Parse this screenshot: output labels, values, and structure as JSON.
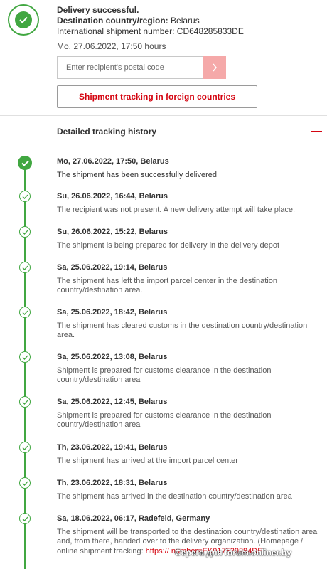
{
  "header": {
    "status_title": "Delivery successful.",
    "destination_label": "Destination country/region:",
    "destination_value": "Belarus",
    "shipment_number_label": "International shipment number:",
    "shipment_number_value": "CD648285833DE",
    "datetime": "Mo, 27.06.2022, 17:50 hours",
    "status_icon": "check-circle-icon",
    "accent_color": "#41a741"
  },
  "postal_form": {
    "placeholder": "Enter recipient's postal code",
    "submit_icon": "chevron-right-icon"
  },
  "tracking_button": {
    "label": "Shipment tracking in foreign countries",
    "color": "#d40511"
  },
  "history": {
    "title": "Detailed tracking history",
    "toggle_icon": "minus-icon"
  },
  "events": [
    {
      "title": "Mo, 27.06.2022, 17:50, Belarus",
      "desc": "The shipment has been successfully delivered"
    },
    {
      "title": "Su, 26.06.2022, 16:44, Belarus",
      "desc": "The recipient was not present. A new delivery attempt will take place."
    },
    {
      "title": "Su, 26.06.2022, 15:22, Belarus",
      "desc": "The shipment is being prepared for delivery in the delivery depot"
    },
    {
      "title": "Sa, 25.06.2022, 19:14, Belarus",
      "desc": "The shipment has left the import parcel center in the destination country/destination area."
    },
    {
      "title": "Sa, 25.06.2022, 18:42, Belarus",
      "desc": "The shipment has cleared customs in the destination country/destination area."
    },
    {
      "title": "Sa, 25.06.2022, 13:08, Belarus",
      "desc": "Shipment is prepared for customs clearance in the destination country/destination area"
    },
    {
      "title": "Sa, 25.06.2022, 12:45, Belarus",
      "desc": "Shipment is prepared for customs clearance in the destination country/destination area"
    },
    {
      "title": "Th, 23.06.2022, 19:41, Belarus",
      "desc": "The shipment has arrived at the import parcel center"
    },
    {
      "title": "Th, 23.06.2022, 18:31, Belarus",
      "desc": "The shipment has arrived in the destination country/destination area"
    },
    {
      "title": "Sa, 18.06.2022, 06:17, Radefeld, Germany",
      "desc": "The shipment will be transported to the destination country/destination area and, from there, handed over to the delivery organization. (Homepage / online shipment tracking:",
      "link": "https://",
      "link_tail": "number=EK017539284DE",
      "after_link": ")"
    }
  ],
  "watermark": "Серега для forum.onliner.by"
}
